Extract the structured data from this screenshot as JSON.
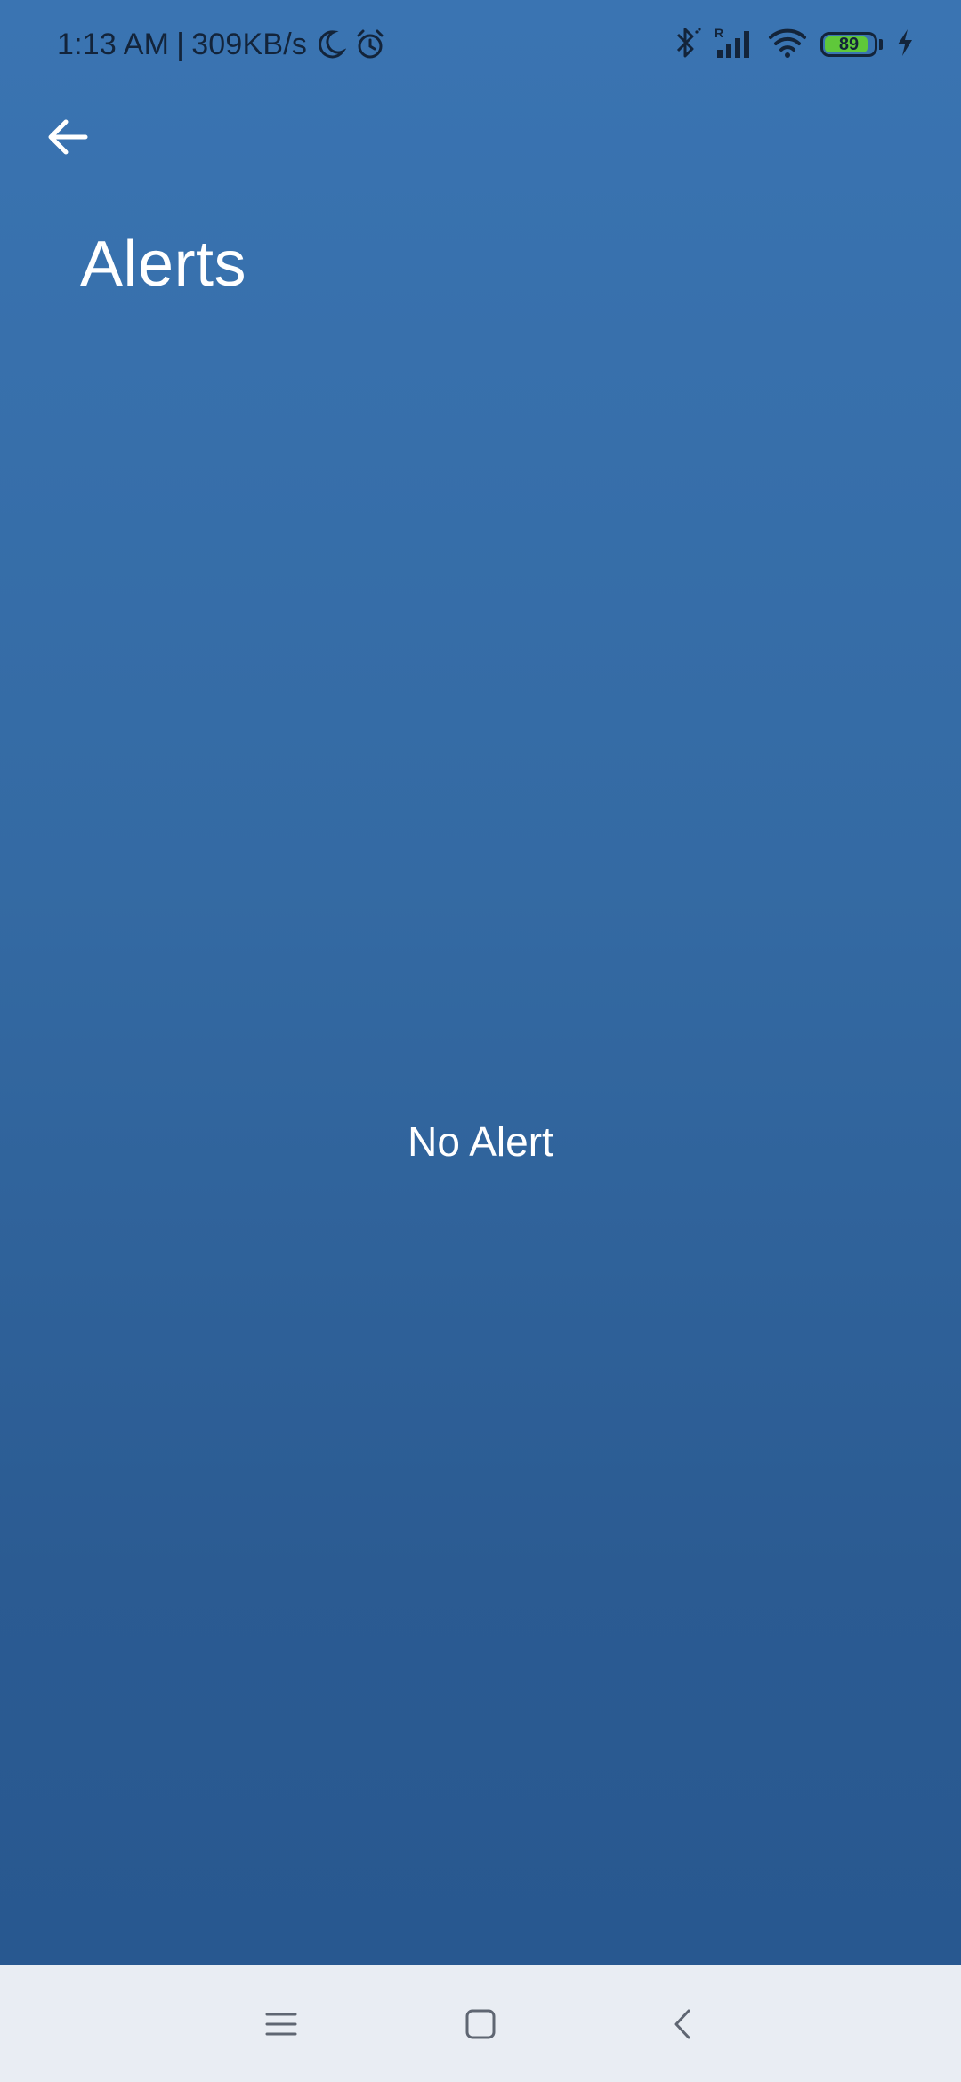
{
  "status_bar": {
    "time": "1:13 AM",
    "separator": "|",
    "network_speed": "309KB/s",
    "battery_level": "89",
    "battery_fraction": 0.89,
    "icons": [
      "moon-icon",
      "alarm-icon",
      "bluetooth-icon",
      "signal-icon",
      "wifi-icon",
      "battery-icon",
      "charging-icon"
    ]
  },
  "header": {
    "back_icon": "arrow-left-icon",
    "title": "Alerts"
  },
  "main": {
    "empty_message": "No Alert"
  },
  "nav_bar": {
    "icons": [
      "menu-icon",
      "home-icon",
      "back-icon"
    ]
  },
  "colors": {
    "background_top": "#3a74b2",
    "background_bottom": "#285890",
    "text": "#ffffff",
    "status_text": "#13243a",
    "nav_background": "#e9edf3",
    "battery_fill": "#5fc83a"
  }
}
